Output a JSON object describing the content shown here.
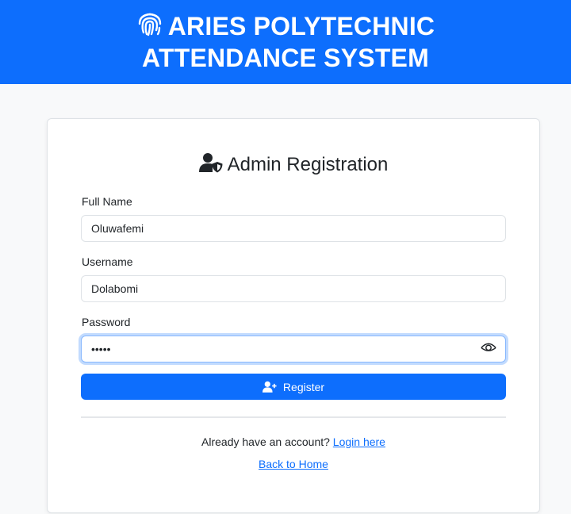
{
  "header": {
    "icon": "fingerprint-icon",
    "title": "ARIES POLYTECHNIC ATTENDANCE SYSTEM"
  },
  "form": {
    "icon": "user-shield-icon",
    "title": "Admin Registration",
    "full_name": {
      "label": "Full Name",
      "value": "Oluwafemi"
    },
    "username": {
      "label": "Username",
      "value": "Dolabomi"
    },
    "password": {
      "label": "Password",
      "value": "•••••",
      "toggle_icon": "eye-icon"
    },
    "register_button": {
      "icon": "user-plus-icon",
      "label": "Register"
    },
    "login_prompt": "Already have an account?",
    "login_link": "Login here",
    "home_link": "Back to Home"
  },
  "colors": {
    "primary": "#0d6efd",
    "background": "#f8f9fa",
    "card": "#ffffff",
    "border": "#dee2e6",
    "focus_border": "#86b7fe"
  }
}
